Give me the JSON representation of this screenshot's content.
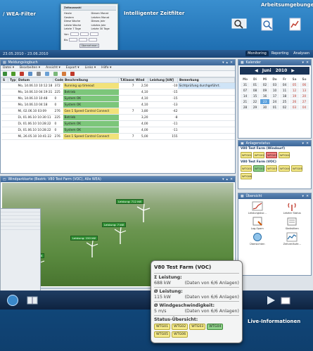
{
  "banners": {
    "wea_filter": "/ WEA-Filter",
    "zeitfilter": "Intelligenter Zeitfilter",
    "arbeitsumgebungen": "Arbeitsumgebungen",
    "live": "Live-Informationen"
  },
  "filter_popup": {
    "title": "Zeitauswahl",
    "cols": [
      "Heute",
      "Gestern",
      "Diese Woche",
      "Letzte Woche",
      "Letzte 7 Tage",
      "Diesen Monat",
      "Letzten Monat",
      "Dieses Jahr",
      "Letztes Jahr",
      "Letzte 30 Tage"
    ],
    "von_label": "Von",
    "bis_label": "Bis",
    "apply_label": "Übernehmen"
  },
  "app": {
    "date_range": "23.05.2010 - 23.06.2010",
    "tabs": [
      "Monitoring",
      "Reporting",
      "Analysen"
    ],
    "active_tab": "Monitoring"
  },
  "log_panel": {
    "title": "Meldungslogbuch",
    "menu": [
      "Datei ▾",
      "Bearbeiten ▾",
      "Ansicht ▾",
      "Export ▾",
      "Links ▾",
      "Hilfe ▾"
    ],
    "columns": [
      "S",
      "Typ",
      "Datum",
      "Code",
      "Beschreibung",
      "T.Klasse",
      "Wind",
      "Leistung [kW]",
      "Bemerkung"
    ],
    "rows": [
      {
        "datum": "Mo, 14.06.10 10:12:18",
        "code": "372",
        "beschreibung": "Running up timeout",
        "tklasse": "7",
        "wind": "2,50",
        "leistung": "-10",
        "bemerkung": "Sichtprüfung durchgeführt.",
        "color": "yellow"
      },
      {
        "datum": "Mo, 14.06.10 04:19:31",
        "code": "225",
        "beschreibung": "Betrieb",
        "tklasse": "",
        "wind": "4,10",
        "leistung": "-15",
        "bemerkung": "",
        "color": "green"
      },
      {
        "datum": "Mo, 14.06.10 10:48",
        "code": "0",
        "beschreibung": "System OK",
        "tklasse": "",
        "wind": "4,10",
        "leistung": "-15",
        "bemerkung": "",
        "color": "green"
      },
      {
        "datum": "Mo, 14.06.10 04:18",
        "code": "0",
        "beschreibung": "System OK",
        "tklasse": "",
        "wind": "4,10",
        "leistung": "-13",
        "bemerkung": "",
        "color": "green"
      },
      {
        "datum": "Mi, 02.06.10 03:09",
        "code": "276",
        "beschreibung": "Gen 1 Speed Control Connect",
        "tklasse": "7",
        "wind": "3,80",
        "leistung": "-42",
        "bemerkung": "",
        "color": "yellow"
      },
      {
        "datum": "Di, 01.06.10 10:30:11",
        "code": "225",
        "beschreibung": "Betrieb",
        "tklasse": "",
        "wind": "3,20",
        "leistung": "-8",
        "bemerkung": "",
        "color": "green"
      },
      {
        "datum": "Di, 01.06.10 10:28:22",
        "code": "0",
        "beschreibung": "System OK",
        "tklasse": "",
        "wind": "4,00",
        "leistung": "-11",
        "bemerkung": "",
        "color": "green"
      },
      {
        "datum": "Di, 01.06.10 10:28:22",
        "code": "0",
        "beschreibung": "System OK",
        "tklasse": "",
        "wind": "4,00",
        "leistung": "-11",
        "bemerkung": "",
        "color": "green"
      },
      {
        "datum": "Mi, 26.05.10 10:41:22",
        "code": "276",
        "beschreibung": "Gen 1 Speed Control Connect",
        "tklasse": "7",
        "wind": "5,00",
        "leistung": "155",
        "bemerkung": "",
        "color": "yellow"
      }
    ]
  },
  "map_panel": {
    "title": "Windparkkarte (Bezirk: V80 Test Farm (VOC), Alle WEA)",
    "labels": [
      "Leistung: 712 kW",
      "Leistung: 7 kW",
      "Leistung: 150 kW",
      "Leistung: 0 kW"
    ]
  },
  "calendar": {
    "title": "Kalender",
    "month": "Juni",
    "year": "2010",
    "dow": [
      "Mo",
      "Di",
      "Mi",
      "Do",
      "Fr",
      "Sa",
      "So"
    ],
    "days": [
      "31",
      "01",
      "02",
      "03",
      "04",
      "05",
      "06",
      "07",
      "08",
      "09",
      "10",
      "11",
      "12",
      "13",
      "14",
      "15",
      "16",
      "17",
      "18",
      "19",
      "20",
      "21",
      "22",
      "23",
      "24",
      "25",
      "26",
      "27",
      "28",
      "29",
      "30",
      "01",
      "02",
      "03",
      "04"
    ],
    "selected_day": "23"
  },
  "anlagen": {
    "title": "Anlagenstatus",
    "groups": [
      {
        "name": "V80 Test Farm (Windsurf)",
        "chips": [
          {
            "label": "WTG01",
            "c": "y"
          },
          {
            "label": "WTG02",
            "c": "y"
          },
          {
            "label": "WTG03",
            "c": "r"
          },
          {
            "label": "WTG04",
            "c": "y"
          }
        ]
      },
      {
        "name": "V80 Test Farm (VOC)",
        "chips": [
          {
            "label": "WTG01",
            "c": "y"
          },
          {
            "label": "WTG02",
            "c": "g"
          },
          {
            "label": "WTG03",
            "c": "y"
          },
          {
            "label": "WTG04",
            "c": "y"
          },
          {
            "label": "WTG05",
            "c": "y"
          },
          {
            "label": "WTG06",
            "c": "y"
          }
        ]
      }
    ]
  },
  "uebersicht": {
    "title": "Übersicht",
    "items": [
      "Leistungskur...",
      "Letzter Status",
      "Log-Spam",
      "Statistiken",
      "Übersichten",
      "Zeitverläufe..."
    ]
  },
  "popup": {
    "title": "V80 Test Farm (VOC)",
    "sum_label": "Σ Leistung:",
    "sum_value": "688 kW",
    "sum_note": "(Daten von 6/6 Anlagen)",
    "avg_label": "Ø Leistung:",
    "avg_value": "115 kW",
    "avg_note": "(Daten von 6/6 Anlagen)",
    "wind_label": "Ø Windgeschwindigkeit:",
    "wind_value": "5 m/s",
    "wind_note": "(Daten von 6/6 Anlagen)",
    "status_label": "Status-Übersicht:",
    "chips": [
      {
        "label": "WTG01",
        "c": "y"
      },
      {
        "label": "WTG02",
        "c": "y"
      },
      {
        "label": "WTG03",
        "c": "y"
      },
      {
        "label": "WTG04",
        "c": "g"
      },
      {
        "label": "WTG05",
        "c": "y"
      },
      {
        "label": "WTG06",
        "c": "y"
      }
    ]
  },
  "colors": {
    "accent": "#1f6fb2",
    "ok": "#7cc67a",
    "warn": "#f2e27a",
    "error": "#f08080"
  }
}
